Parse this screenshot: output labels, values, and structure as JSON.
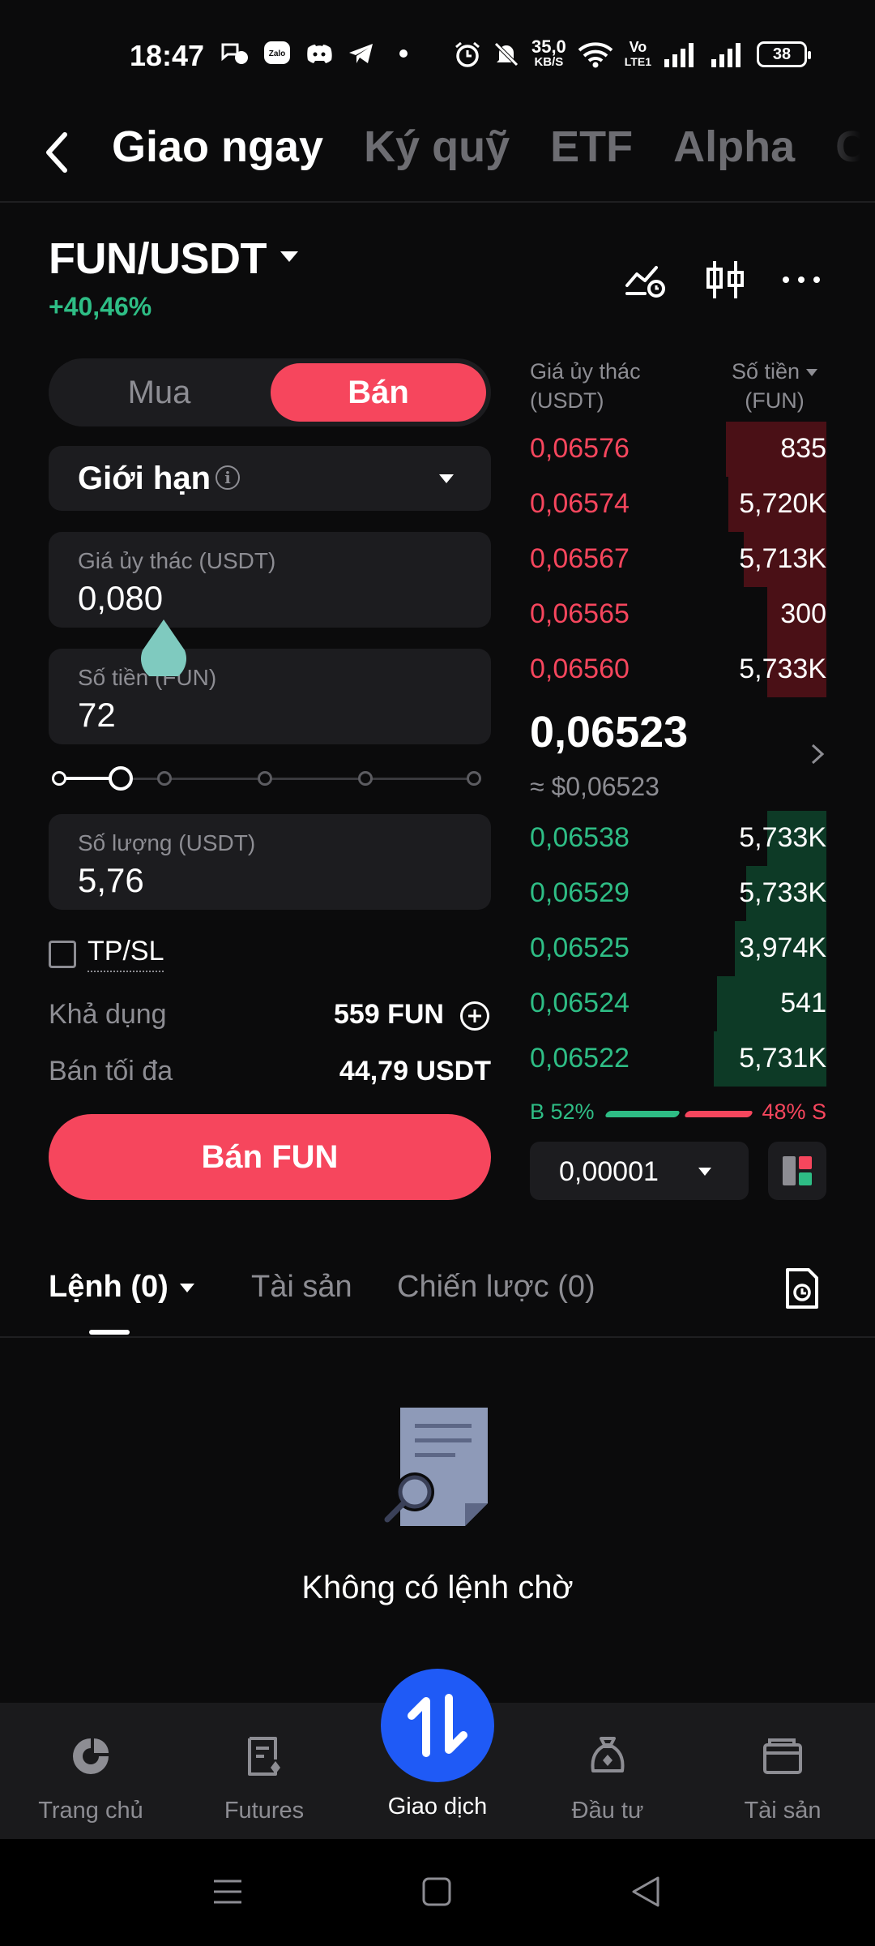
{
  "status_bar": {
    "time": "18:47",
    "net_speed_value": "35,0",
    "net_speed_unit": "KB/S",
    "volte_top": "Vo",
    "volte_bottom": "LTE1",
    "battery": "38"
  },
  "top_tabs": [
    "Giao ngay",
    "Ký quỹ",
    "ETF",
    "Alpha",
    "C"
  ],
  "pair": {
    "symbol": "FUN/USDT",
    "change": "+40,46%"
  },
  "trade_form": {
    "side_buy": "Mua",
    "side_sell": "Bán",
    "order_type": "Giới hạn",
    "price_label": "Giá ủy thác (USDT)",
    "price_value": "0,080",
    "amount_label": "Số tiền (FUN)",
    "amount_value": "72",
    "slider_percent": 13,
    "qty_label": "Số lượng (USDT)",
    "qty_value": "5,76",
    "tpsl_label": "TP/SL",
    "available_label": "Khả dụng",
    "available_value": "559 FUN",
    "max_sell_label": "Bán tối đa",
    "max_sell_value": "44,79 USDT",
    "submit_label": "Bán FUN"
  },
  "order_book": {
    "price_header_line1": "Giá ủy thác",
    "price_header_line2": "(USDT)",
    "amount_header_line1": "Số tiền",
    "amount_header_line2": "(FUN)",
    "asks": [
      {
        "price": "0,06576",
        "amount": "835",
        "depth": 0.34
      },
      {
        "price": "0,06574",
        "amount": "5,720K",
        "depth": 0.33
      },
      {
        "price": "0,06567",
        "amount": "5,713K",
        "depth": 0.28
      },
      {
        "price": "0,06565",
        "amount": "300",
        "depth": 0.2
      },
      {
        "price": "0,06560",
        "amount": "5,733K",
        "depth": 0.2
      }
    ],
    "last_price": "0,06523",
    "last_price_usd": "≈ $0,06523",
    "bids": [
      {
        "price": "0,06538",
        "amount": "5,733K",
        "depth": 0.2
      },
      {
        "price": "0,06529",
        "amount": "5,733K",
        "depth": 0.27
      },
      {
        "price": "0,06525",
        "amount": "3,974K",
        "depth": 0.31
      },
      {
        "price": "0,06524",
        "amount": "541",
        "depth": 0.37
      },
      {
        "price": "0,06522",
        "amount": "5,731K",
        "depth": 0.38
      }
    ],
    "buy_ratio": "B 52%",
    "sell_ratio": "48% S",
    "tick_size": "0,00001"
  },
  "orders_section": {
    "tabs": [
      "Lệnh (0)",
      "Tài sản",
      "Chiến lược (0)"
    ],
    "empty_message": "Không có lệnh chờ"
  },
  "bottom_nav": [
    "Trang chủ",
    "Futures",
    "Giao dịch",
    "Đầu tư",
    "Tài sản"
  ],
  "colors": {
    "sell": "#f6465d",
    "buy": "#2ebd85",
    "accent": "#1f5af6",
    "background": "#0b0b0c"
  }
}
